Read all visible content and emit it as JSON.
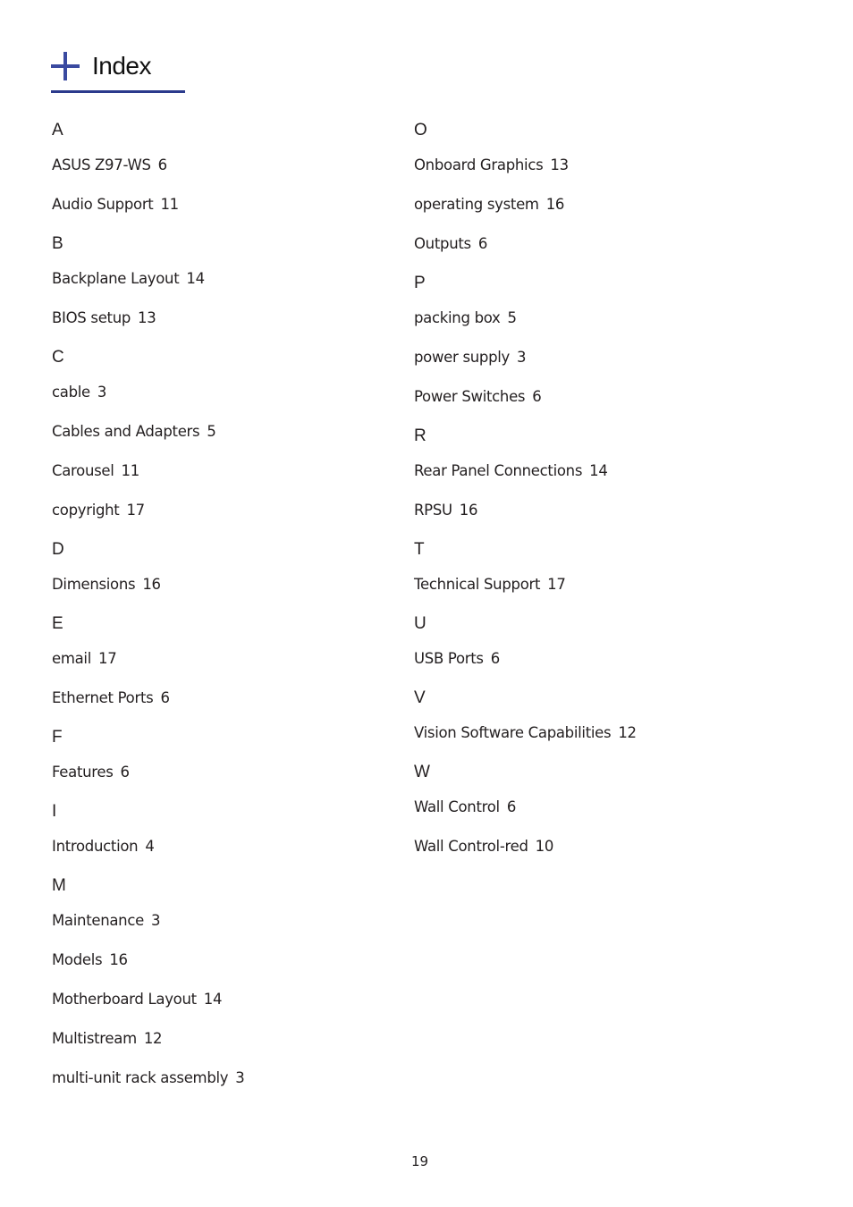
{
  "header": {
    "title": "Index",
    "icon": "plus-icon",
    "accent_color": "#2b3a8c"
  },
  "left_column": [
    {
      "letter": "A",
      "entries": [
        {
          "term": "ASUS Z97-WS",
          "page": "6"
        },
        {
          "term": "Audio Support",
          "page": "11"
        }
      ]
    },
    {
      "letter": "B",
      "entries": [
        {
          "term": "Backplane Layout",
          "page": "14"
        },
        {
          "term": "BIOS setup",
          "page": "13"
        }
      ]
    },
    {
      "letter": "C",
      "entries": [
        {
          "term": "cable",
          "page": "3"
        },
        {
          "term": "Cables and Adapters",
          "page": "5"
        },
        {
          "term": "Carousel",
          "page": "11"
        },
        {
          "term": "copyright",
          "page": "17"
        }
      ]
    },
    {
      "letter": "D",
      "entries": [
        {
          "term": "Dimensions",
          "page": "16"
        }
      ]
    },
    {
      "letter": "E",
      "entries": [
        {
          "term": "email",
          "page": "17"
        },
        {
          "term": "Ethernet Ports",
          "page": "6"
        }
      ]
    },
    {
      "letter": "F",
      "entries": [
        {
          "term": "Features",
          "page": "6"
        }
      ]
    },
    {
      "letter": "I",
      "entries": [
        {
          "term": "Introduction",
          "page": "4"
        }
      ]
    },
    {
      "letter": "M",
      "entries": [
        {
          "term": "Maintenance",
          "page": "3"
        },
        {
          "term": "Models",
          "page": "16"
        },
        {
          "term": "Motherboard Layout",
          "page": "14"
        },
        {
          "term": "Multistream",
          "page": "12"
        },
        {
          "term": "multi-unit rack assembly",
          "page": "3"
        }
      ]
    }
  ],
  "right_column": [
    {
      "letter": "O",
      "entries": [
        {
          "term": "Onboard Graphics",
          "page": "13"
        },
        {
          "term": "operating system",
          "page": "16"
        },
        {
          "term": "Outputs",
          "page": "6"
        }
      ]
    },
    {
      "letter": "P",
      "entries": [
        {
          "term": "packing box",
          "page": "5"
        },
        {
          "term": "power supply",
          "page": "3"
        },
        {
          "term": "Power Switches",
          "page": "6"
        }
      ]
    },
    {
      "letter": "R",
      "entries": [
        {
          "term": "Rear Panel Connections",
          "page": "14"
        },
        {
          "term": "RPSU",
          "page": "16"
        }
      ]
    },
    {
      "letter": "T",
      "entries": [
        {
          "term": "Technical Support",
          "page": "17"
        }
      ]
    },
    {
      "letter": "U",
      "entries": [
        {
          "term": "USB Ports",
          "page": "6"
        }
      ]
    },
    {
      "letter": "V",
      "entries": [
        {
          "term": "Vision Software Capabilities",
          "page": "12"
        }
      ]
    },
    {
      "letter": "W",
      "entries": [
        {
          "term": "Wall Control",
          "page": "6"
        },
        {
          "term": "Wall Control-red",
          "page": "10"
        }
      ]
    }
  ],
  "footer": {
    "page_number": "19"
  }
}
